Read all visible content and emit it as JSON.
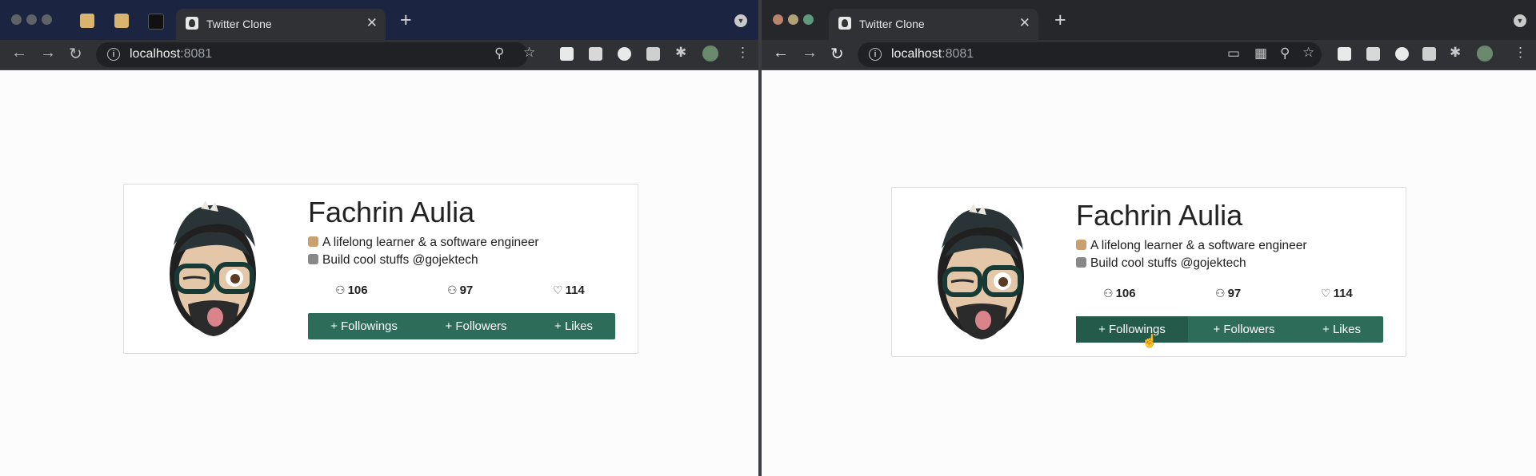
{
  "left_window": {
    "tab_title": "Twitter Clone",
    "tab_close": "✕",
    "new_tab": "+",
    "url_host": "localhost",
    "url_port": ":8081"
  },
  "right_window": {
    "tab_title": "Twitter Clone",
    "tab_close": "✕",
    "new_tab": "+",
    "url_host": "localhost",
    "url_port": ":8081"
  },
  "profile": {
    "name": "Fachrin Aulia",
    "bio_line_1": "A lifelong learner & a software engineer",
    "bio_line_2": "Build cool stuffs @gojektech",
    "stats": {
      "followings": "106",
      "followers": "97",
      "likes": "114"
    },
    "buttons": {
      "followings": "+ Followings",
      "followers": "+ Followers",
      "likes": "+ Likes"
    }
  },
  "colors": {
    "accent_button": "#2c6c58",
    "left_tabbar": "#1b2440",
    "right_tabbar": "#25272b"
  },
  "icons": [
    "back-arrow-icon",
    "forward-arrow-icon",
    "reload-icon",
    "info-icon",
    "zoom-icon",
    "star-icon",
    "extensions-icon",
    "user-outline-icon",
    "heart-outline-icon",
    "hand-cursor-icon"
  ]
}
